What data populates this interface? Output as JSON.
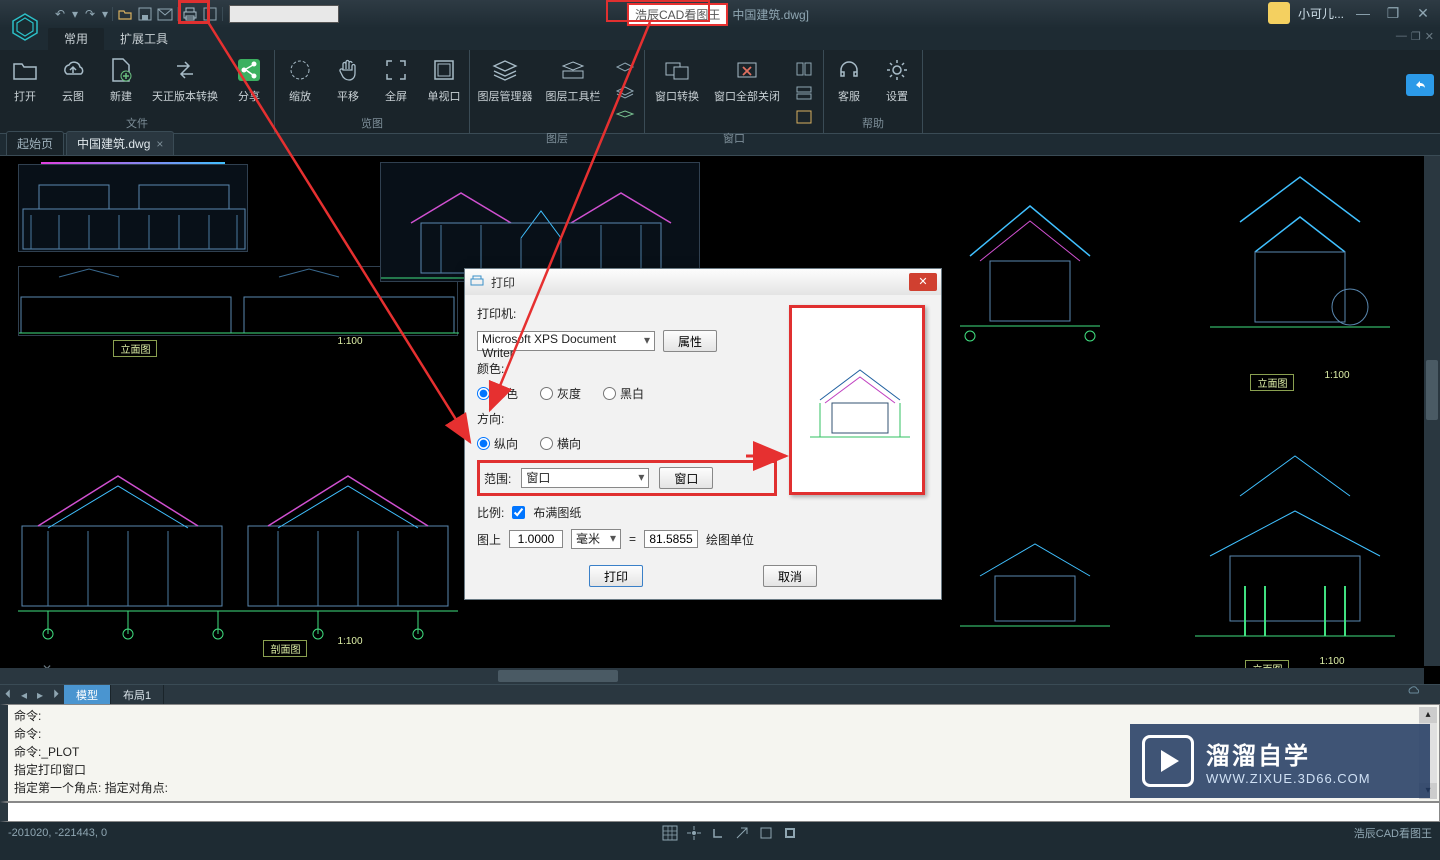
{
  "title": {
    "app": "浩辰CAD看图王",
    "doc": "中国建筑.dwg]"
  },
  "user": {
    "name": "小可儿..."
  },
  "menubar": {
    "tab1": "常用",
    "tab2": "扩展工具"
  },
  "ribbon": {
    "file": {
      "open": "打开",
      "cloud": "云图",
      "new": "新建",
      "tz": "天正版本转换",
      "share": "分享",
      "group": "文件"
    },
    "view": {
      "zoom": "缩放",
      "pan": "平移",
      "full": "全屏",
      "vp": "单视口",
      "group": "览图"
    },
    "layer": {
      "mgr": "图层管理器",
      "tool": "图层工具栏",
      "group": "图层"
    },
    "window": {
      "conv": "窗口转换",
      "closeall": "窗口全部关闭",
      "group": "窗口"
    },
    "help": {
      "cs": "客服",
      "set": "设置",
      "group": "帮助"
    }
  },
  "filetabs": {
    "start": "起始页",
    "doc": "中国建筑.dwg"
  },
  "bottomtabs": {
    "model": "模型",
    "layout1": "布局1"
  },
  "cmd": {
    "l1": "命令:",
    "l2": "命令:",
    "l3": "命令:_PLOT",
    "l4": "指定打印窗口",
    "l5": "指定第一个角点: 指定对角点:"
  },
  "status": {
    "coord": "-201020, -221443, 0",
    "right": "浩辰CAD看图王"
  },
  "dialog": {
    "title": "打印",
    "printer_label": "打印机:",
    "printer_value": "Microsoft XPS Document Writer",
    "prop": "属性",
    "color_label": "颜色:",
    "color1": "彩色",
    "color2": "灰度",
    "color3": "黑白",
    "orient_label": "方向:",
    "orient1": "纵向",
    "orient2": "横向",
    "range_label": "范围:",
    "range_value": "窗口",
    "range_btn": "窗口",
    "scale_label": "比例:",
    "fit": "布满图纸",
    "onpaper": "图上",
    "v1": "1.0000",
    "unit": "毫米",
    "eq": "=",
    "v2": "81.5855",
    "unit2": "绘图单位",
    "ok": "打印",
    "cancel": "取消"
  },
  "canvas_labels": {
    "elev1": "立面图",
    "scale100": "1:100",
    "section": "剖面图",
    "elev_r": "立面图"
  },
  "watermark": {
    "l1": "溜溜自学",
    "l2": "WWW.ZIXUE.3D66.COM"
  }
}
